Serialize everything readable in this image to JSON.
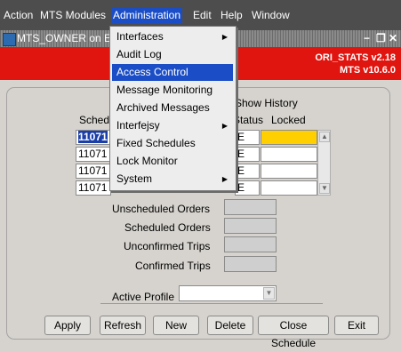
{
  "menubar": {
    "items": [
      "Action",
      "MTS Modules",
      "Administration",
      "Edit",
      "Help",
      "Window"
    ],
    "active": "Administration"
  },
  "window": {
    "title": "MTS_OWNER on E",
    "controls": [
      "−",
      "❐",
      "✕"
    ]
  },
  "banner": {
    "line1": "ORI_STATS v2.18",
    "line2": "MTS v10.6.0",
    "color": "#e0150f"
  },
  "dropdown": {
    "items": [
      {
        "label": "Interfaces",
        "submenu": true
      },
      {
        "label": "Audit Log",
        "submenu": false
      },
      {
        "label": "Access Control",
        "submenu": false,
        "highlighted": true
      },
      {
        "label": "Message Monitoring",
        "submenu": false
      },
      {
        "label": "Archived Messages",
        "submenu": false
      },
      {
        "label": "Interfejsy",
        "submenu": true
      },
      {
        "label": "Fixed Schedules",
        "submenu": false
      },
      {
        "label": "Lock Monitor",
        "submenu": false
      },
      {
        "label": "System",
        "submenu": true
      }
    ]
  },
  "form": {
    "show_history_label": "Show History",
    "sched_label": "Sched",
    "status_label": "Status",
    "locked_label": "Locked",
    "rows": [
      {
        "sched": "11071",
        "status": "E",
        "selected": true
      },
      {
        "sched": "11071",
        "status": "E",
        "selected": false
      },
      {
        "sched": "11071",
        "status": "E",
        "selected": false
      },
      {
        "sched": "11071",
        "status": "E",
        "selected": false
      }
    ],
    "counts": [
      {
        "label": "Unscheduled Orders",
        "value": ""
      },
      {
        "label": "Scheduled Orders",
        "value": ""
      },
      {
        "label": "Unconfirmed Trips",
        "value": ""
      },
      {
        "label": "Confirmed Trips",
        "value": ""
      }
    ],
    "active_profile_label": "Active Profile",
    "active_profile_value": ""
  },
  "buttons": [
    "Apply",
    "Refresh",
    "New",
    "Delete",
    "Close Schedule",
    "Exit"
  ],
  "colors": {
    "menubar_bg": "#4d4d4d",
    "highlight": "#1b4ec6",
    "locked_field": "#ffcf00"
  }
}
